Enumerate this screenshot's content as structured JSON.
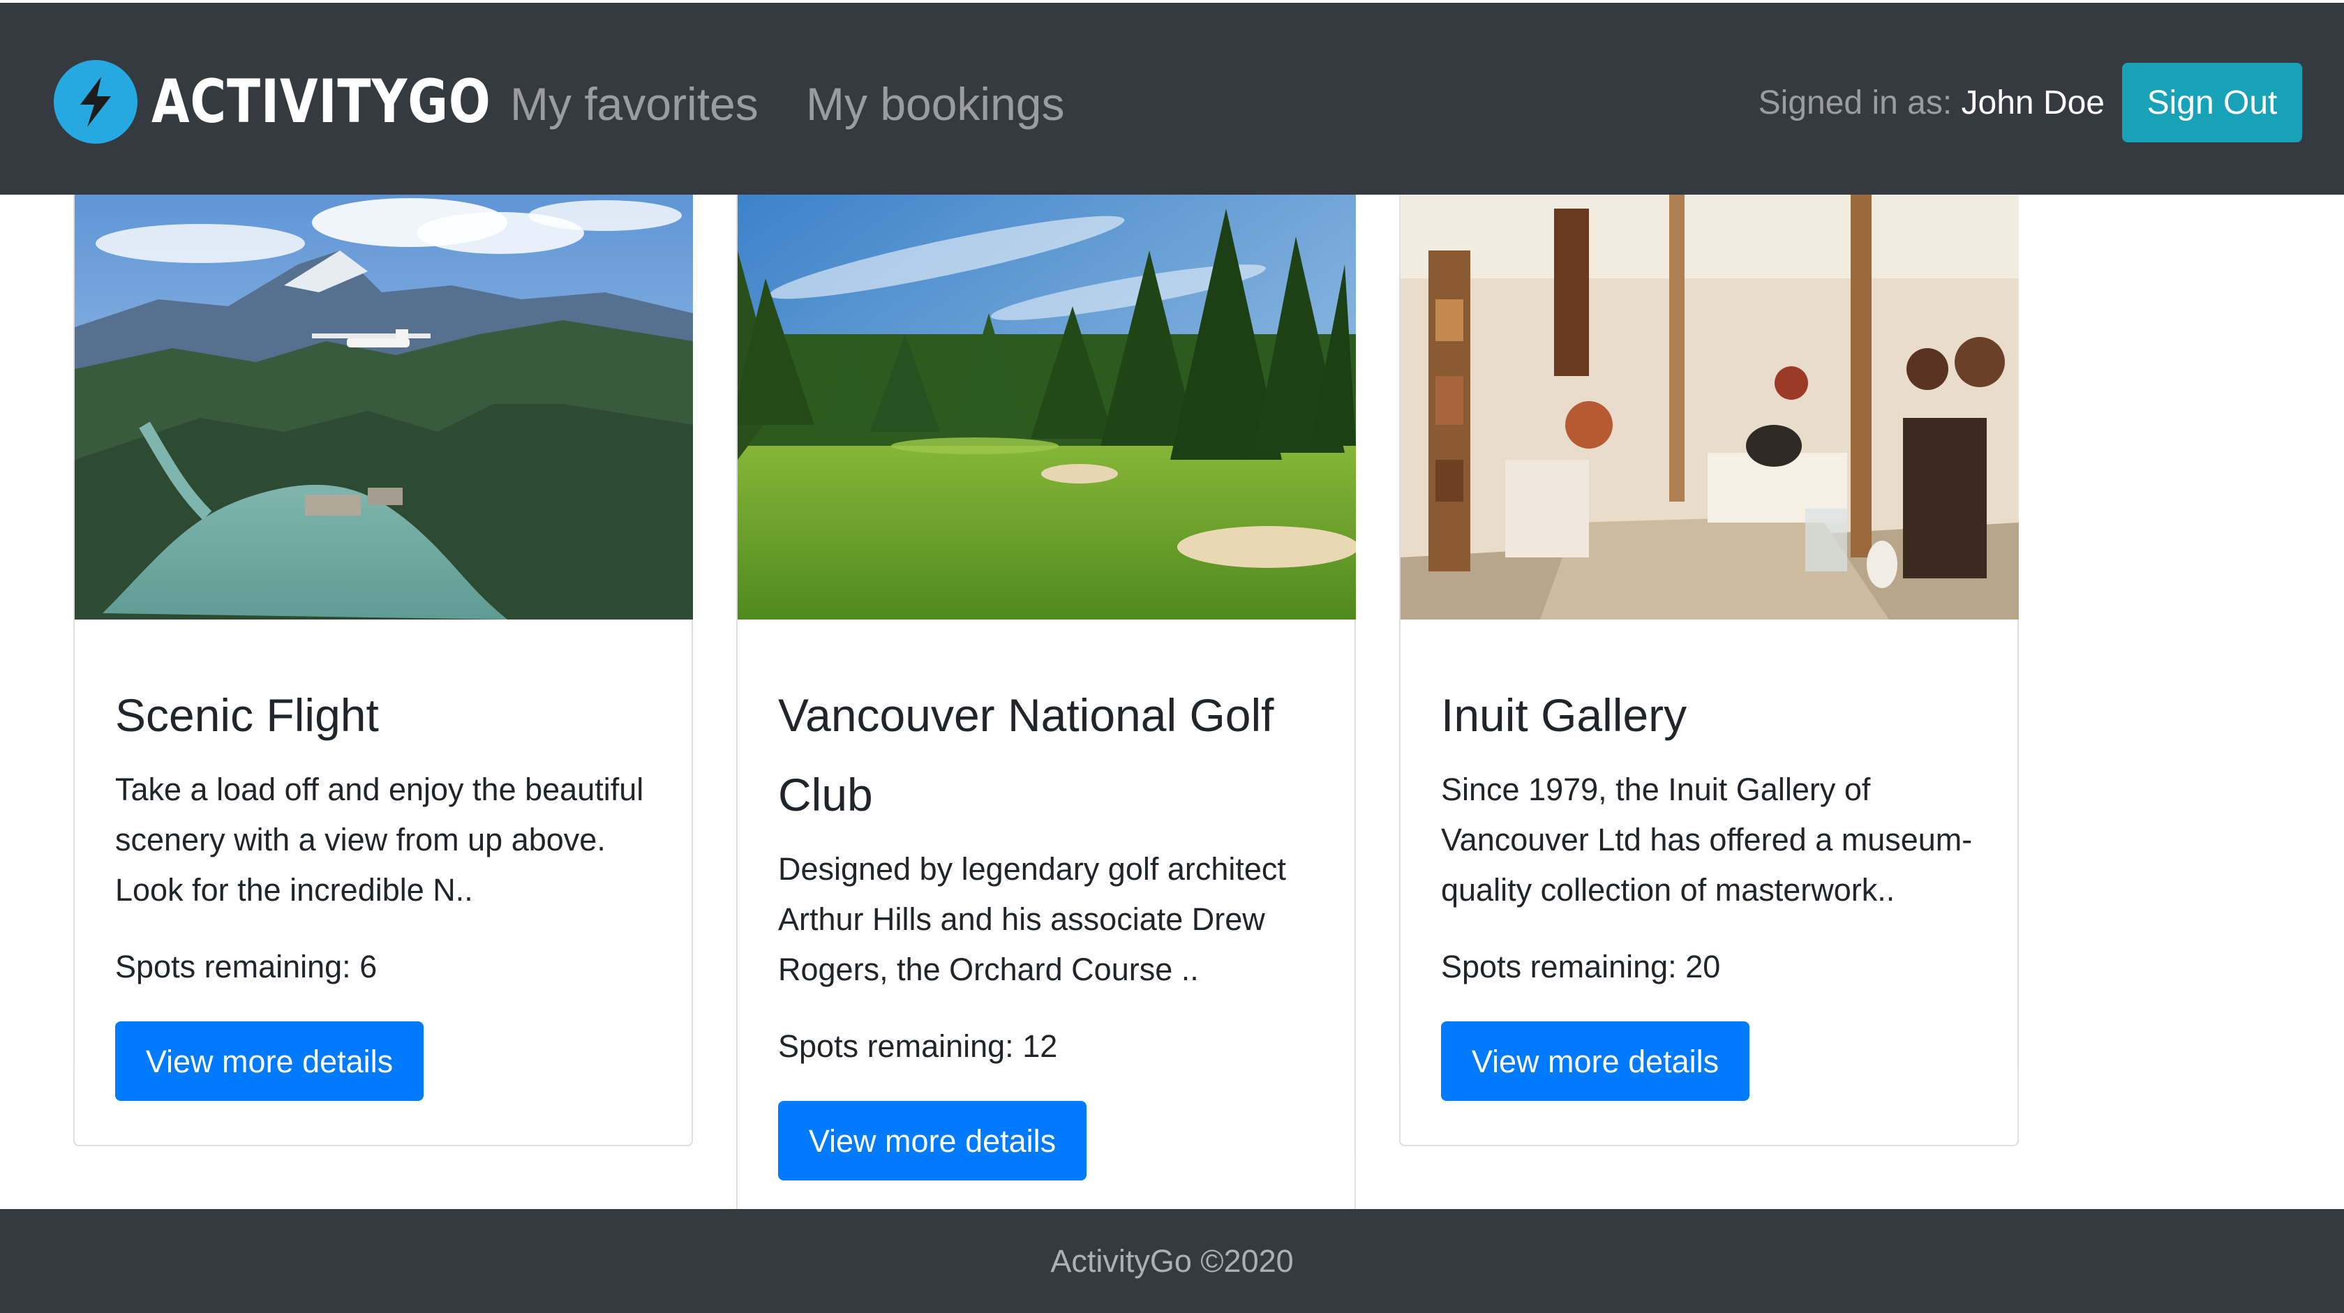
{
  "header": {
    "brand_name": "ACTIVITYGO",
    "nav": [
      "My favorites",
      "My bookings"
    ],
    "signed_in_label": "Signed in as:",
    "user_name": "John Doe",
    "signout_label": "Sign Out"
  },
  "cards": [
    {
      "title": "Scenic Flight",
      "description": "Take a load off and enjoy the beautiful scenery with a view from up above. Look for the incredible N..",
      "spots_label": "Spots remaining:",
      "spots": "6",
      "button_label": "View more details"
    },
    {
      "title": "Vancouver National Golf Club",
      "description": "Designed by legendary golf architect Arthur Hills and his associate Drew Rogers, the Orchard Course ..",
      "spots_label": "Spots remaining:",
      "spots": "12",
      "button_label": "View more details"
    },
    {
      "title": "Inuit Gallery",
      "description": "Since 1979, the Inuit Gallery of Vancouver Ltd has offered a museum-quality collection of masterwork..",
      "spots_label": "Spots remaining:",
      "spots": "20",
      "button_label": "View more details"
    }
  ],
  "footer": {
    "text": "ActivityGo ©2020"
  },
  "colors": {
    "navbar": "#343a40",
    "primary": "#007bff",
    "info": "#17a2b8",
    "logo": "#26a9e0"
  },
  "icons": {
    "logo": "lightning-bolt-icon"
  }
}
